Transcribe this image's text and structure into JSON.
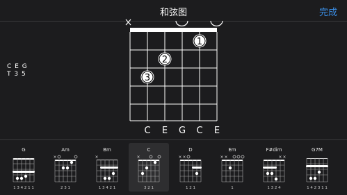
{
  "navbar": {
    "title": "和弦图",
    "done_label": "完成"
  },
  "chord_info": {
    "notes": "C E G",
    "intervals": "T 3 5"
  },
  "diagram": {
    "strings": [
      "X",
      "",
      "O",
      "",
      "O",
      ""
    ],
    "fingers": [
      {
        "string": 5,
        "fret": 1,
        "finger": "1"
      },
      {
        "string": 3,
        "fret": 2,
        "finger": "2"
      },
      {
        "string": 1,
        "fret": 3,
        "finger": "3"
      }
    ],
    "bottom_notes": [
      "C",
      "E",
      "G",
      "C",
      "E"
    ]
  },
  "thumbnails": [
    {
      "name": "G",
      "marks": "",
      "fingers": "1 3 4 2 1 1",
      "selected": false
    },
    {
      "name": "Am",
      "marks": "×O    O",
      "fingers": "2 3 1",
      "selected": false
    },
    {
      "name": "Bm",
      "marks": "×",
      "fingers": "1 3 4 2 1",
      "selected": false
    },
    {
      "name": "C",
      "marks": "×    O  O",
      "fingers": "3 2   1",
      "selected": true
    },
    {
      "name": "D",
      "marks": "××O",
      "fingers": "1 2 1",
      "selected": false
    },
    {
      "name": "Em",
      "marks": "×× OOO",
      "fingers": "1",
      "selected": false
    },
    {
      "name": "F#dim",
      "marks": "××",
      "fingers": "1 3 2 4",
      "selected": false
    },
    {
      "name": "G7M",
      "marks": "",
      "fingers": "1 4 2 3 1 1",
      "selected": false
    }
  ]
}
